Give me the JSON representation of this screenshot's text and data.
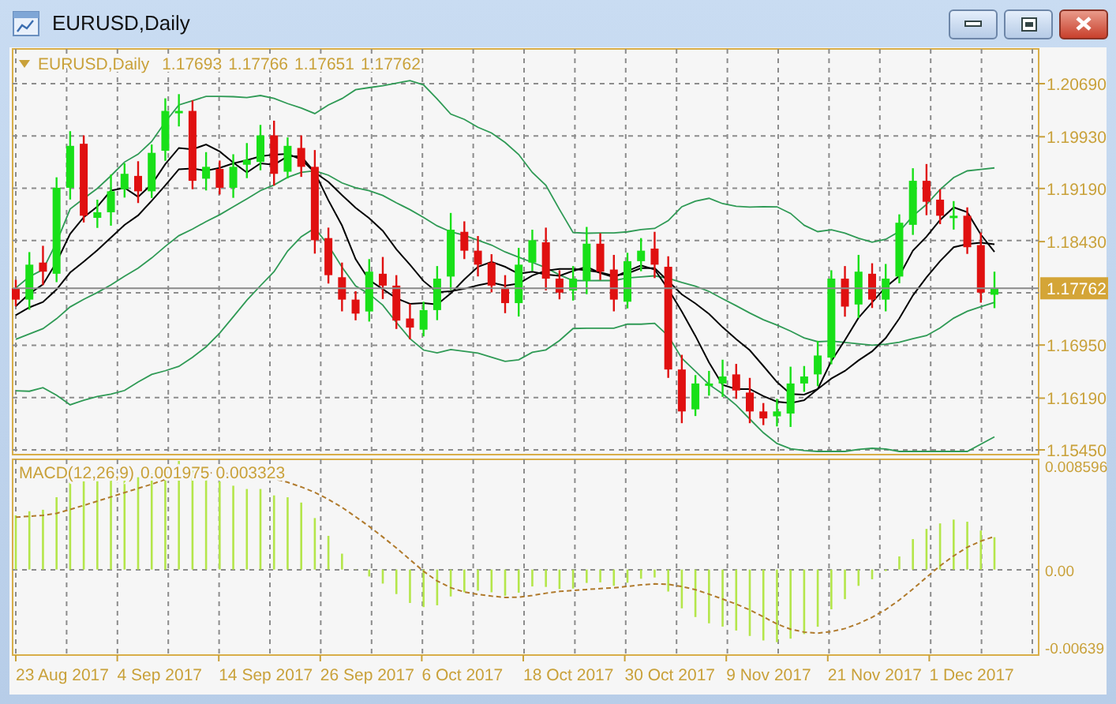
{
  "window": {
    "title": "EURUSD,Daily"
  },
  "legend": {
    "symbol": "EURUSD,Daily",
    "values": [
      "1.17693",
      "1.17766",
      "1.17651",
      "1.17762"
    ]
  },
  "price_axis": {
    "labels": [
      "1.20690",
      "1.19930",
      "1.19190",
      "1.18430",
      "1.16950",
      "1.16190",
      "1.15450"
    ],
    "current_price": "1.17762"
  },
  "macd": {
    "label": "MACD(12,26,9)",
    "values": [
      "0.001975",
      "0.003323"
    ],
    "axis_labels": [
      "0.008596",
      "0.00",
      "-0.00639"
    ]
  },
  "time_axis": {
    "labels": [
      "23 Aug 2017",
      "4 Sep 2017",
      "14 Sep 2017",
      "26 Sep 2017",
      "6 Oct 2017",
      "18 Oct 2017",
      "30 Oct 2017",
      "9 Nov 2017",
      "21 Nov 2017",
      "1 Dec 2017"
    ]
  }
}
